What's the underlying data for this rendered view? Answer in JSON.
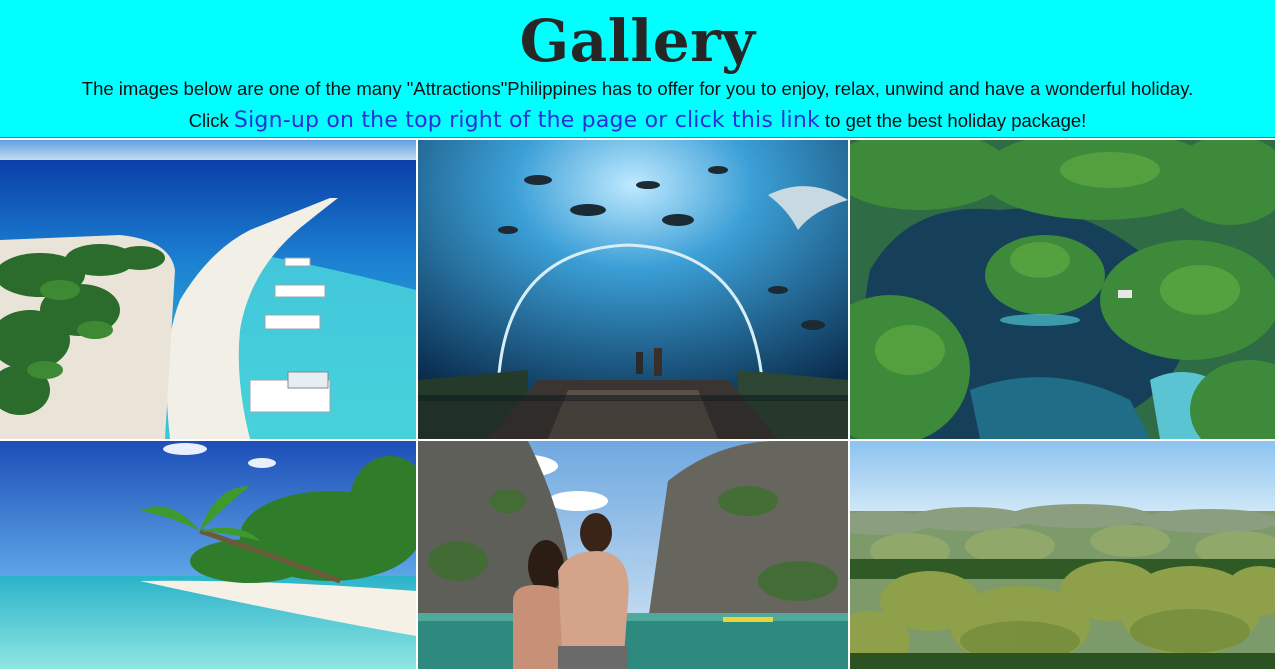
{
  "page": {
    "title": "Gallery",
    "description": "The images below are one of the many \"Attractions\"Philippines has to offer for you to enjoy, relax, unwind and have a wonderful holiday.",
    "cta_prefix": "Click ",
    "cta_link": "Sign-up on the top right of the page or click this link",
    "cta_suffix": " to get the best holiday package!"
  },
  "colors": {
    "header_bg": "#00ffff",
    "link": "#2f2fd6",
    "title": "#262626"
  },
  "gallery": {
    "images": [
      {
        "name": "white-sand-beach-sandbar-photo"
      },
      {
        "name": "oceanarium-tunnel-photo"
      },
      {
        "name": "lagoon-islands-aerial-photo"
      },
      {
        "name": "palm-tree-beach-photo"
      },
      {
        "name": "couple-limestone-cliffs-photo"
      },
      {
        "name": "chocolate-hills-photo"
      }
    ]
  }
}
